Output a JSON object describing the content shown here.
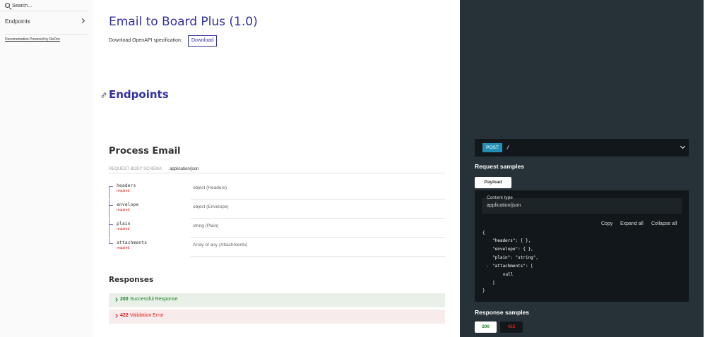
{
  "sidebar": {
    "search_placeholder": "Search...",
    "items": [
      {
        "label": "Endpoints"
      }
    ],
    "powered_by": "Documentation Powered by ReDoc"
  },
  "header": {
    "title": "Email to Board Plus (1.0)",
    "download_text": "Download OpenAPI specification:",
    "download_label": "Download"
  },
  "section": {
    "title": "Endpoints"
  },
  "operation": {
    "title": "Process Email",
    "request_body_label": "Request Body schema:",
    "content_type": "application/json",
    "properties": [
      {
        "name": "headers",
        "required": "required",
        "type": "object (Headers)"
      },
      {
        "name": "envelope",
        "required": "required",
        "type": "object (Envelope)"
      },
      {
        "name": "plain",
        "required": "required",
        "type": "string (Plain)"
      },
      {
        "name": "attachments",
        "required": "required",
        "type": "Array of any (Attachments)"
      }
    ]
  },
  "responses": {
    "title": "Responses",
    "items": [
      {
        "code": "200",
        "description": "Successful Response"
      },
      {
        "code": "422",
        "description": "Validation Error"
      }
    ]
  },
  "right_panel": {
    "method": "POST",
    "path": "/",
    "request_samples_title": "Request samples",
    "payload_tab": "Payload",
    "content_type_label": "Content type",
    "content_type_value": "application/json",
    "actions": {
      "copy": "Copy",
      "expand_all": "Expand all",
      "collapse_all": "Collapse all"
    },
    "json_lines": [
      "{",
      "\"headers\": { },",
      "\"envelope\": { },",
      "\"plain\": \"string\",",
      "\"attachments\": [",
      "null",
      "]",
      "}"
    ],
    "collapse_toggle": "-",
    "response_samples_title": "Response samples",
    "response_tabs": [
      "200",
      "422"
    ]
  },
  "colors": {
    "accent": "#32329f",
    "panel_bg": "#263238",
    "success": "#1d8127",
    "error": "#d41f1c",
    "method_post": "#248fb2"
  },
  "icons": [
    "search-icon",
    "chevron-right-icon",
    "link-icon",
    "chevron-down-icon"
  ]
}
